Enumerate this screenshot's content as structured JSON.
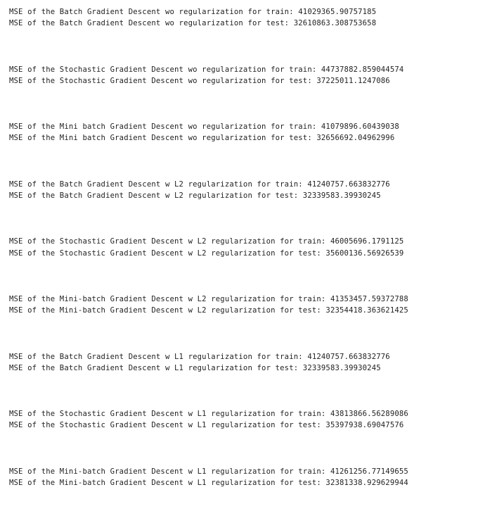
{
  "output": {
    "blocks": [
      {
        "train": "MSE of the Batch Gradient Descent wo regularization for train: 41029365.90757185",
        "test": "MSE of the Batch Gradient Descent wo regularization for test: 32610863.308753658"
      },
      {
        "train": "MSE of the Stochastic Gradient Descent wo regularization for train: 44737882.859044574",
        "test": "MSE of the Stochastic Gradient Descent wo regularization for test: 37225011.1247086"
      },
      {
        "train": "MSE of the Mini batch Gradient Descent wo regularization for train: 41079896.60439038",
        "test": "MSE of the Mini batch Gradient Descent wo regularization for test: 32656692.04962996"
      },
      {
        "train": "MSE of the Batch Gradient Descent w L2 regularization for train: 41240757.663832776",
        "test": "MSE of the Batch Gradient Descent w L2 regularization for test: 32339583.39930245"
      },
      {
        "train": "MSE of the Stochastic Gradient Descent w L2 regularization for train: 46005696.1791125",
        "test": "MSE of the Stochastic Gradient Descent w L2 regularization for test: 35600136.56926539"
      },
      {
        "train": "MSE of the Mini-batch Gradient Descent w L2 regularization for train: 41353457.59372788",
        "test": "MSE of the Mini-batch Gradient Descent w L2 regularization for test: 32354418.363621425"
      },
      {
        "train": "MSE of the Batch Gradient Descent w L1 regularization for train: 41240757.663832776",
        "test": "MSE of the Batch Gradient Descent w L1 regularization for test: 32339583.39930245"
      },
      {
        "train": "MSE of the Stochastic Gradient Descent w L1 regularization for train: 43813866.56289086",
        "test": "MSE of the Stochastic Gradient Descent w L1 regularization for test: 35397938.69047576"
      },
      {
        "train": "MSE of the Mini-batch Gradient Descent w L1 regularization for train: 41261256.77149655",
        "test": "MSE of the Mini-batch Gradient Descent w L1 regularization for test: 32381338.929629944"
      }
    ]
  }
}
